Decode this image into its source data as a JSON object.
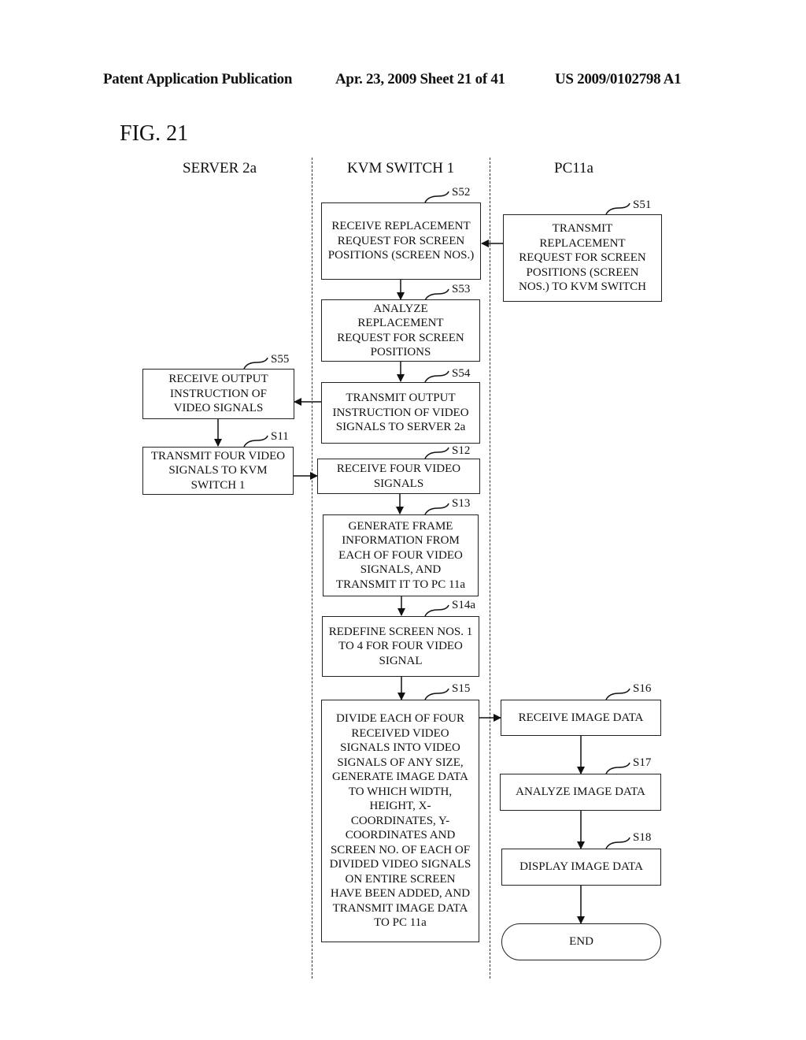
{
  "header": {
    "left": "Patent Application Publication",
    "center": "Apr. 23, 2009  Sheet 21 of 41",
    "right": "US 2009/0102798 A1"
  },
  "figure": {
    "title": "FIG. 21"
  },
  "columns": [
    "SERVER 2a",
    "KVM SWITCH 1",
    "PC11a"
  ],
  "steps": {
    "s51": {
      "id": "S51",
      "text": "TRANSMIT REPLACEMENT REQUEST FOR SCREEN POSITIONS (SCREEN NOS.) TO KVM SWITCH"
    },
    "s52": {
      "id": "S52",
      "text": "RECEIVE REPLACEMENT REQUEST FOR SCREEN POSITIONS (SCREEN NOS.)"
    },
    "s53": {
      "id": "S53",
      "text": "ANALYZE REPLACEMENT REQUEST FOR SCREEN POSITIONS"
    },
    "s54": {
      "id": "S54",
      "text": "TRANSMIT OUTPUT INSTRUCTION OF VIDEO SIGNALS TO SERVER 2a"
    },
    "s55": {
      "id": "S55",
      "text": "RECEIVE OUTPUT INSTRUCTION OF VIDEO SIGNALS"
    },
    "s11": {
      "id": "S11",
      "text": "TRANSMIT FOUR VIDEO SIGNALS TO KVM SWITCH 1"
    },
    "s12": {
      "id": "S12",
      "text": "RECEIVE FOUR VIDEO SIGNALS"
    },
    "s13": {
      "id": "S13",
      "text": "GENERATE FRAME INFORMATION FROM EACH OF FOUR VIDEO SIGNALS, AND TRANSMIT IT TO PC 11a"
    },
    "s14a": {
      "id": "S14a",
      "text": "REDEFINE SCREEN NOS. 1 TO 4 FOR FOUR VIDEO SIGNAL"
    },
    "s15": {
      "id": "S15",
      "text": "DIVIDE EACH OF FOUR RECEIVED VIDEO SIGNALS INTO VIDEO SIGNALS OF ANY SIZE, GENERATE IMAGE DATA TO WHICH WIDTH, HEIGHT, X-COORDINATES, Y-COORDINATES AND SCREEN NO. OF EACH OF DIVIDED VIDEO SIGNALS ON ENTIRE SCREEN HAVE BEEN ADDED, AND TRANSMIT IMAGE DATA TO PC 11a"
    },
    "s16": {
      "id": "S16",
      "text": "RECEIVE IMAGE DATA"
    },
    "s17": {
      "id": "S17",
      "text": "ANALYZE IMAGE DATA"
    },
    "s18": {
      "id": "S18",
      "text": "DISPLAY IMAGE DATA"
    },
    "end": {
      "text": "END"
    }
  }
}
